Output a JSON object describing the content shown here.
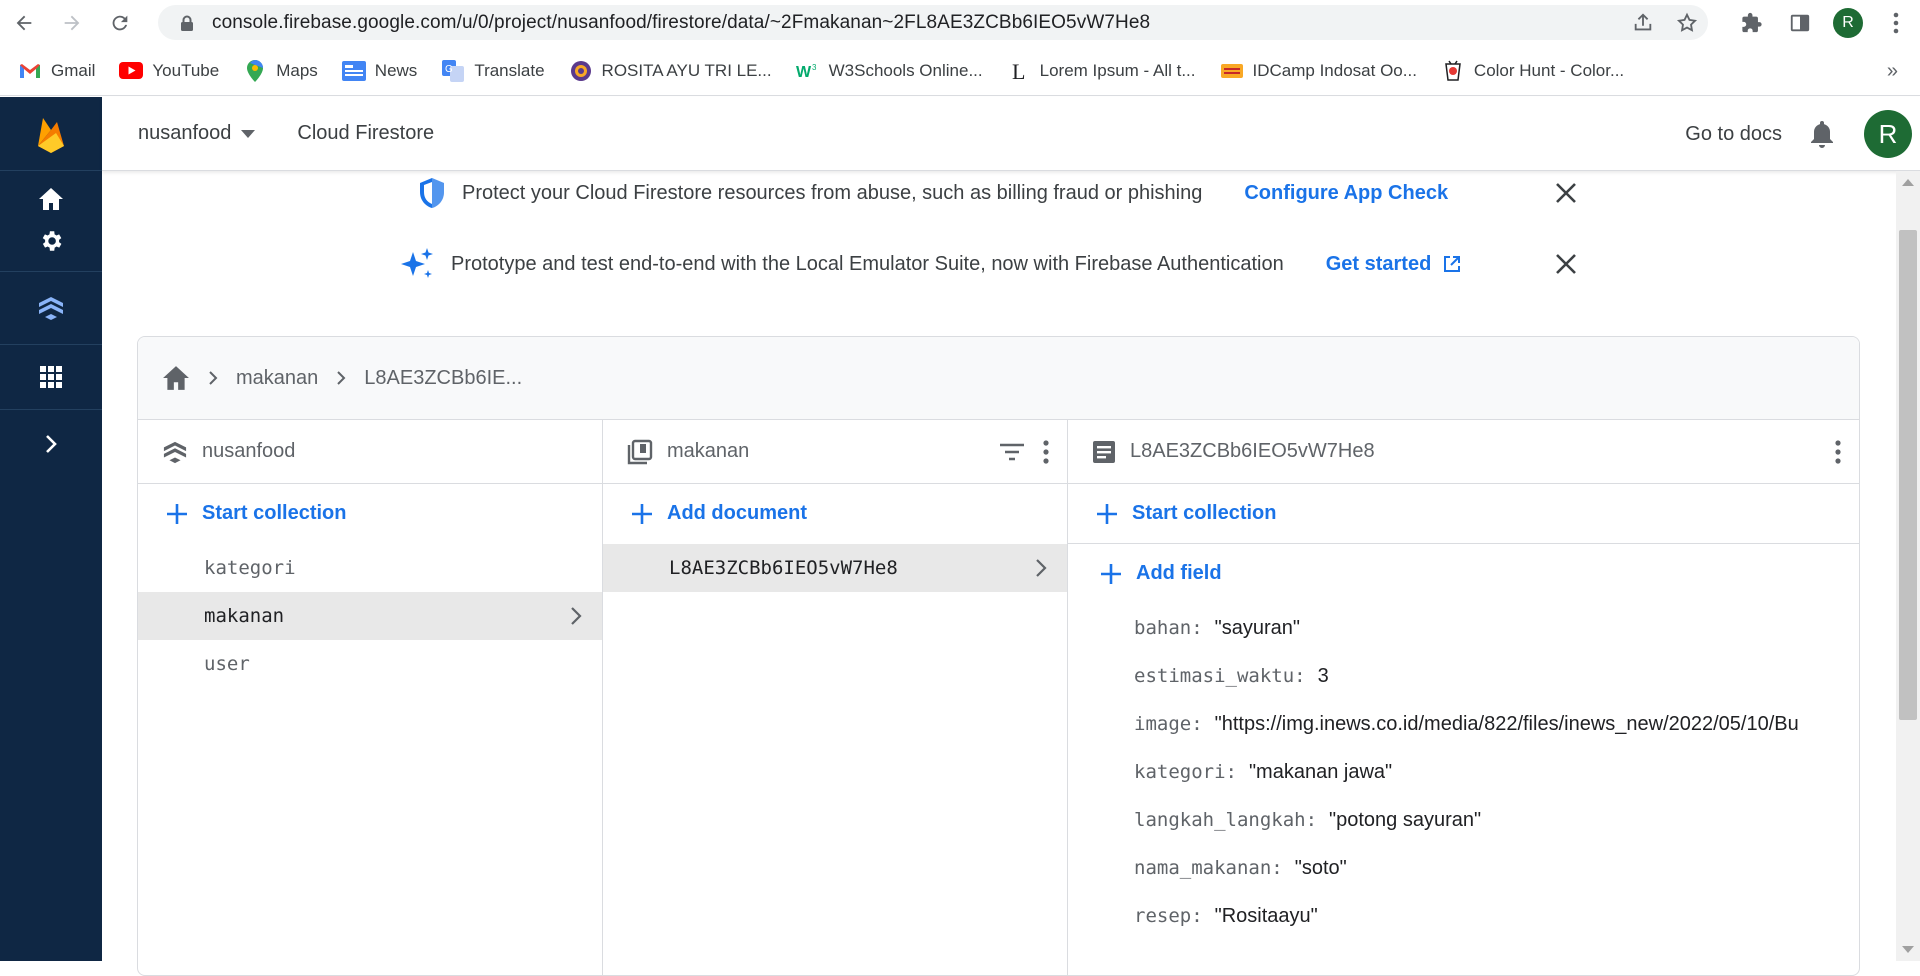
{
  "browser": {
    "url": "console.firebase.google.com/u/0/project/nusanfood/firestore/data/~2Fmakanan~2FL8AE3ZCBb6IEO5vW7He8",
    "profile_initial": "R",
    "bookmarks": [
      {
        "label": "Gmail",
        "icon": "gmail-icon",
        "color": "#ea4335"
      },
      {
        "label": "YouTube",
        "icon": "youtube-icon",
        "color": "#ff0000"
      },
      {
        "label": "Maps",
        "icon": "maps-icon",
        "color": "#34a853"
      },
      {
        "label": "News",
        "icon": "news-icon",
        "color": "#4285f4"
      },
      {
        "label": "Translate",
        "icon": "translate-icon",
        "color": "#4285f4"
      },
      {
        "label": "ROSITA AYU TRI LE...",
        "icon": "university-icon",
        "color": "#5b3a8c"
      },
      {
        "label": "W3Schools Online...",
        "icon": "w3schools-icon",
        "color": "#04aa6d"
      },
      {
        "label": "Lorem Ipsum - All t...",
        "icon": "lorem-icon",
        "color": "#202124"
      },
      {
        "label": "IDCamp Indosat Oo...",
        "icon": "idcamp-icon",
        "color": "#f9a825"
      },
      {
        "label": "Color Hunt - Color...",
        "icon": "colorhunt-icon",
        "color": "#e53935"
      }
    ],
    "more_label": "»"
  },
  "header": {
    "project": "nusanfood",
    "product": "Cloud Firestore",
    "docs_label": "Go to docs",
    "avatar_initial": "R"
  },
  "banners": {
    "app_check": {
      "message": "Protect your Cloud Firestore resources from abuse, such as billing fraud or phishing",
      "action": "Configure App Check"
    },
    "emulator": {
      "message": "Prototype and test end-to-end with the Local Emulator Suite, now with Firebase Authentication",
      "action": "Get started"
    }
  },
  "breadcrumb": {
    "collection": "makanan",
    "document": "L8AE3ZCBb6IE..."
  },
  "columns": {
    "root": {
      "title": "nusanfood",
      "add_label": "Start collection",
      "items": [
        "kategori",
        "makanan",
        "user"
      ],
      "selected_index": 1
    },
    "collection": {
      "title": "makanan",
      "add_label": "Add document",
      "items": [
        "L8AE3ZCBb6IEO5vW7He8"
      ],
      "selected_index": 0
    },
    "document": {
      "title": "L8AE3ZCBb6IEO5vW7He8",
      "start_collection_label": "Start collection",
      "add_field_label": "Add field",
      "fields": [
        {
          "key": "bahan:",
          "value": "\"sayuran\""
        },
        {
          "key": "estimasi_waktu:",
          "value": "3"
        },
        {
          "key": "image:",
          "value": "\"https://img.inews.co.id/media/822/files/inews_new/2022/05/10/Bu"
        },
        {
          "key": "kategori:",
          "value": "\"makanan jawa\""
        },
        {
          "key": "langkah_langkah:",
          "value": "\"potong sayuran\""
        },
        {
          "key": "nama_makanan:",
          "value": "\"soto\""
        },
        {
          "key": "resep:",
          "value": "\"Rositaayu\""
        }
      ]
    }
  },
  "colors": {
    "rail": "#0f2744",
    "accent": "#1a73e8",
    "firebase_yellow": "#ffca28",
    "firebase_orange": "#f57c00"
  }
}
